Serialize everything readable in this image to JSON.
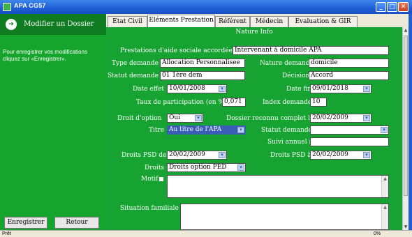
{
  "window": {
    "title": "APA CG57",
    "minimize": "_",
    "maximize": "□",
    "close": "✕"
  },
  "sidebar": {
    "arrow": "➜",
    "title": "Modifier un Dossier",
    "help": "Pour enregistrer vos modifications cliquez sur «Enregistrer».",
    "save_label": "Enregistrer",
    "back_label": "Retour"
  },
  "tabs": [
    "Etat Civil",
    "Eléments Prestation",
    "Référent",
    "Médecin",
    "Evaluation & GIR"
  ],
  "section_title": "Nature Info",
  "form": {
    "prestations_label": "Prestations d'aide sociale accordées",
    "prestations_value": "Intervenant à domicile APA",
    "type_demande_label": "Type demande",
    "type_demande_value": "Allocation Personnalisee",
    "nature_demande_label": "Nature demande",
    "nature_demande_value": "domicile",
    "statut_demande_label": "Statut demande",
    "statut_demande_value": "01 1ère dem",
    "decision_label": "Décision",
    "decision_value": "Accord",
    "date_effet_label": "Date effet",
    "date_effet_value": "10/01/2008",
    "date_fin_label": "Date fin",
    "date_fin_value": "09/01/2018",
    "taux_label": "Taux de participation (en %)",
    "taux_value": "0,071",
    "index_label": "Index demande",
    "index_value": "10",
    "droit_option_label": "Droit d'option",
    "droit_option_value": "Oui",
    "dossier_reconnu_label": "Dossier reconnu complet le",
    "dossier_reconnu_value": "20/02/2009",
    "titre_label": "Titre",
    "titre_value": "Au titre de l'APA",
    "statut_demande2_label": "Statut demande",
    "statut_demande2_value": "",
    "suivi_label": "Suivi annuel n°",
    "suivi_value": "",
    "droits_psd_de_label": "Droits PSD de",
    "droits_psd_de_value": "20/02/2009",
    "droits_psd_a_label": "Droits PSD à",
    "droits_psd_a_value": "20/02/2009",
    "droits_label": "Droits",
    "droits_value": "Droits option PED",
    "motif_label": "Motif",
    "situation_label": "Situation familiale"
  },
  "status": {
    "text": "Prêt",
    "progress": "0%"
  },
  "icons": {
    "dropdown": "▾",
    "scroll_up": "▲",
    "scroll_down": "▼"
  }
}
